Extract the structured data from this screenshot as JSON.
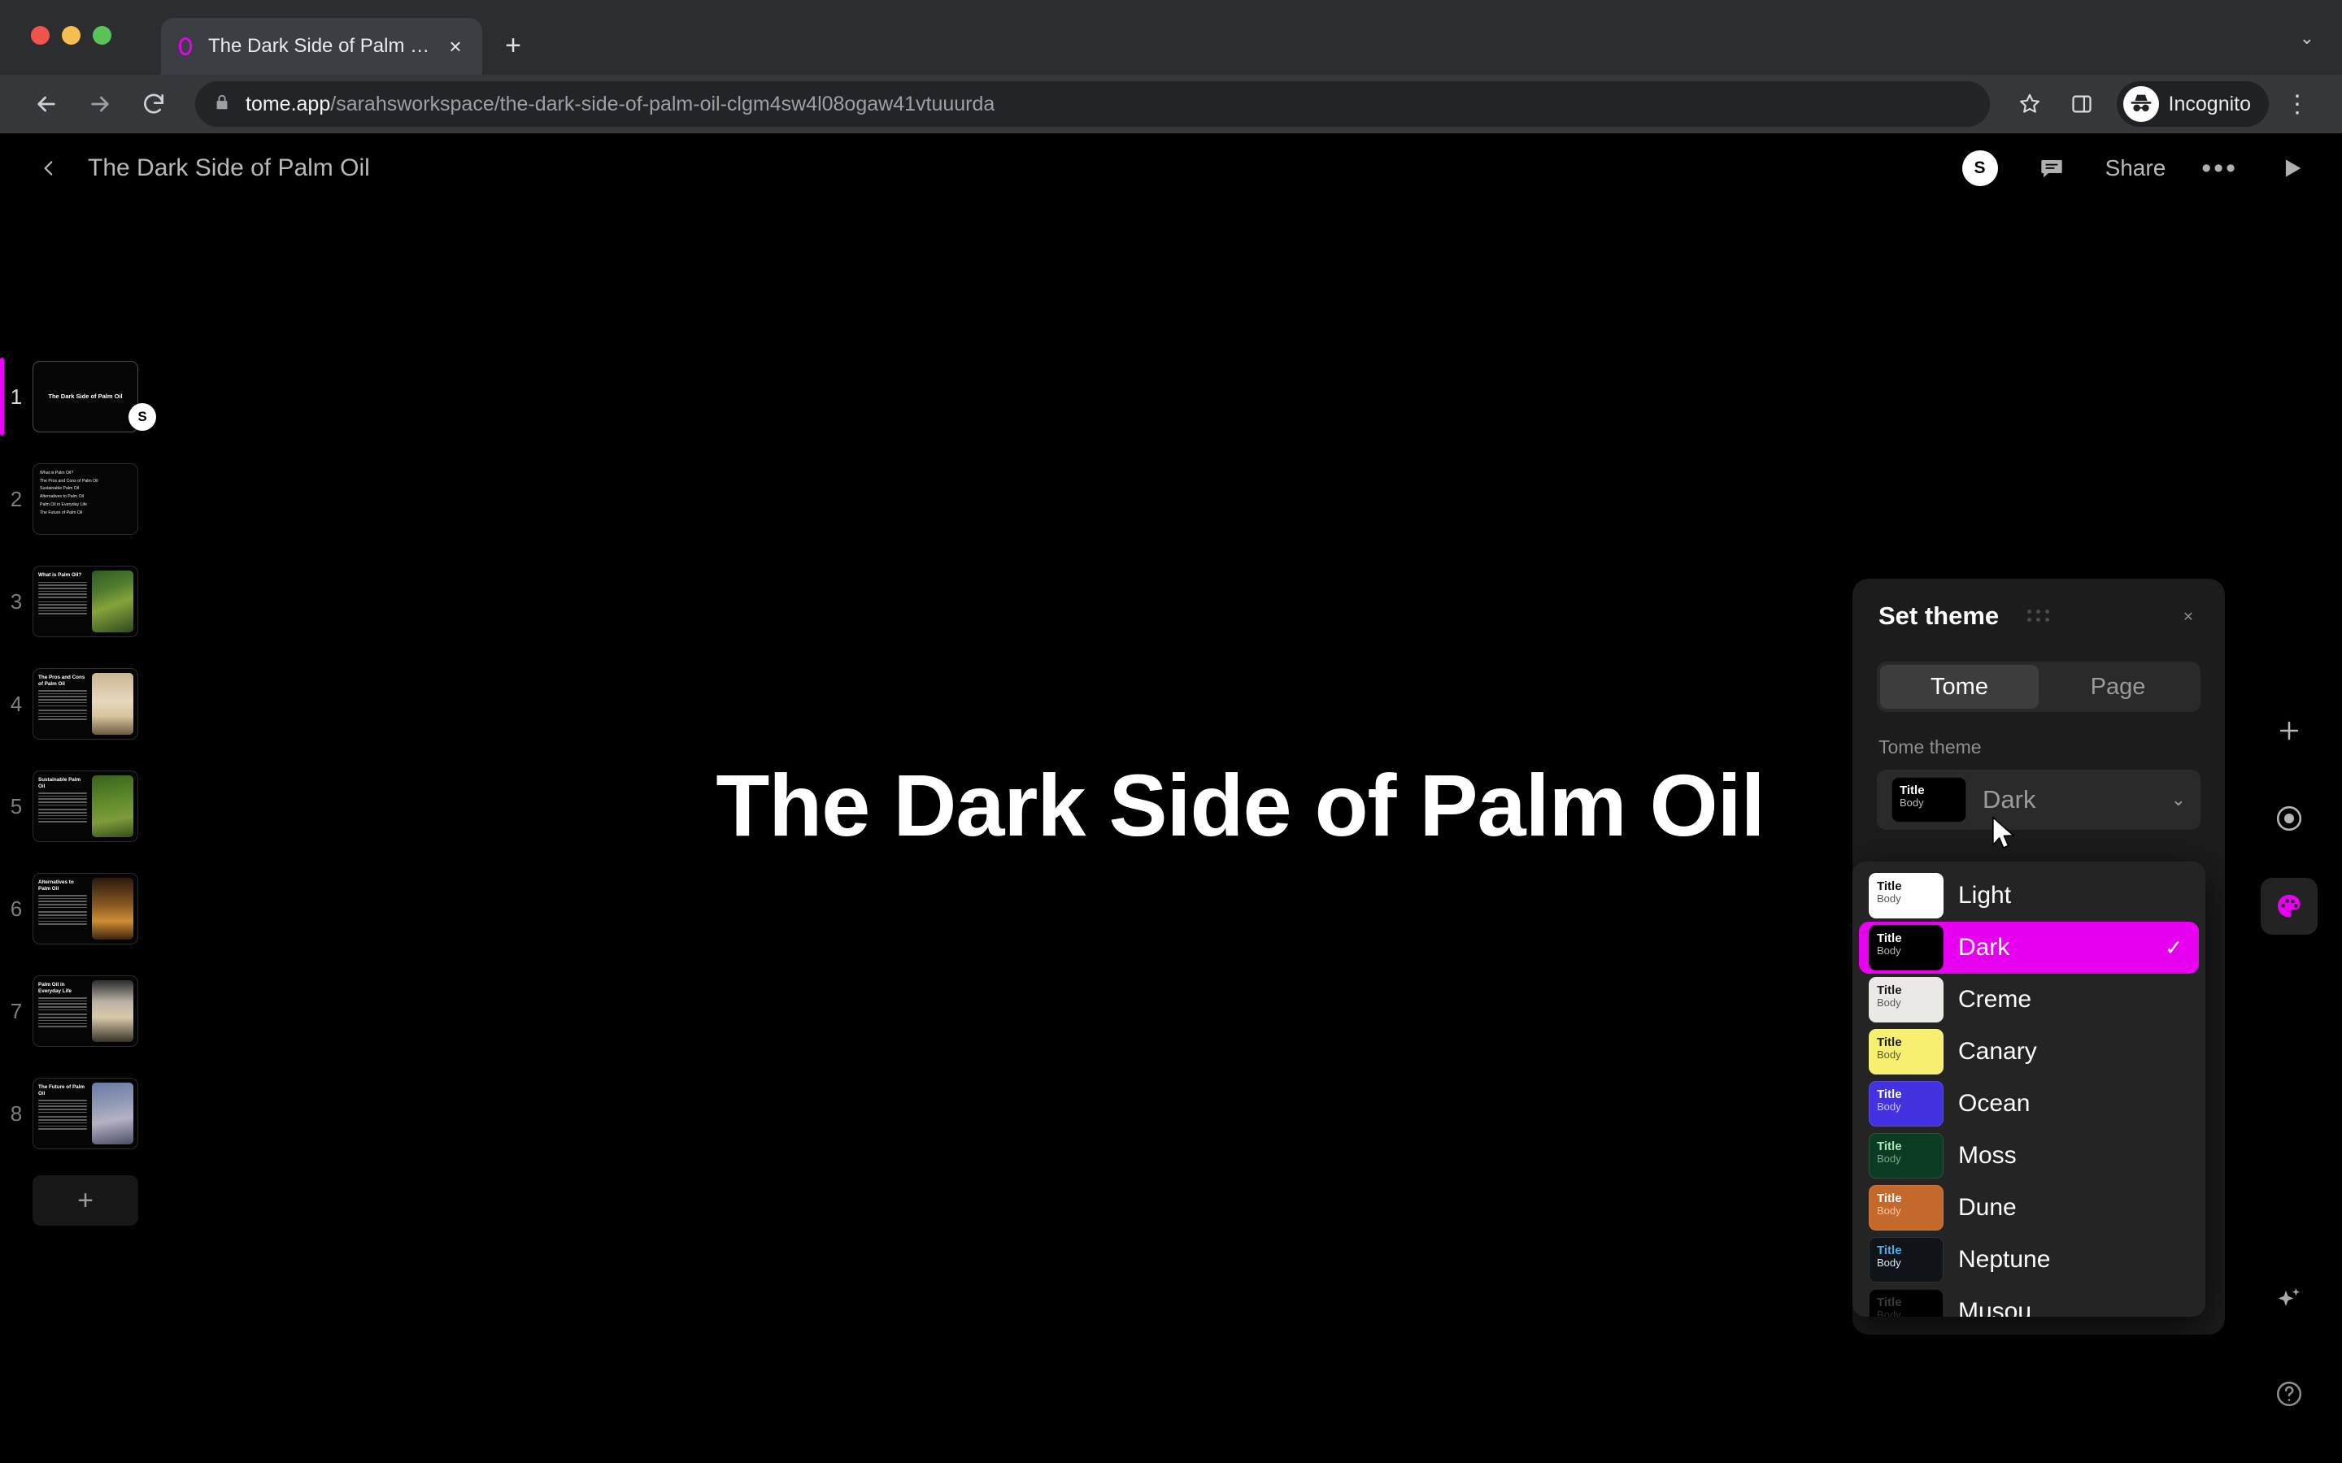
{
  "browser": {
    "tab": {
      "title": "The Dark Side of Palm Oil",
      "favicon": "tome-logo-icon",
      "close": "×"
    },
    "new_tab": "+",
    "tabstrip_chevron": "⌄",
    "nav": {
      "back": "←",
      "forward": "→",
      "reload": "↻"
    },
    "omnibox": {
      "lock": "lock-icon",
      "host": "tome.app",
      "path": "/sarahsworkspace/the-dark-side-of-palm-oil-clgm4sw4l08ogaw41vtuuurda"
    },
    "bookmark": "☆",
    "side_panel": "side-panel-icon",
    "profile": {
      "label": "Incognito",
      "icon": "incognito-icon"
    },
    "menu": "⋮"
  },
  "app": {
    "header": {
      "back": "‹",
      "title": "The Dark Side of Palm Oil",
      "avatar": "S",
      "comment_icon": "comment-icon",
      "share_label": "Share",
      "more": "•••",
      "play_icon": "play-icon"
    },
    "canvas": {
      "slide_title": "The Dark Side of Palm Oil"
    },
    "add_slide": "+",
    "tools": {
      "add": "+",
      "record": "record-icon",
      "theme": "palette-icon",
      "ai": "sparkles-icon",
      "help": "?"
    },
    "slides": [
      {
        "num": "1",
        "type": "title",
        "title": "The Dark Side of Palm Oil",
        "active": true,
        "avatar": "S"
      },
      {
        "num": "2",
        "type": "list",
        "items": [
          "What is Palm Oil?",
          "The Pros and Cons of Palm Oil",
          "Sustainable Palm Oil",
          "Alternatives to Palm Oil",
          "Palm Oil in Everyday Life",
          "The Future of Palm Oil"
        ]
      },
      {
        "num": "3",
        "type": "split",
        "title": "What is Palm Oil?",
        "image": "img-jungle"
      },
      {
        "num": "4",
        "type": "split",
        "title": "The Pros and Cons of Palm Oil",
        "image": "img-sunset"
      },
      {
        "num": "5",
        "type": "split",
        "title": "Sustainable Palm Oil",
        "image": "img-plantation"
      },
      {
        "num": "6",
        "type": "split",
        "title": "Alternatives to Palm Oil",
        "image": "img-bottles"
      },
      {
        "num": "7",
        "type": "split",
        "title": "Palm Oil in Everyday Life",
        "image": "img-shelf"
      },
      {
        "num": "8",
        "type": "split",
        "title": "The Future of Palm Oil",
        "image": "img-city"
      }
    ]
  },
  "theme_panel": {
    "title": "Set theme",
    "close": "✕",
    "tabs": [
      {
        "label": "Tome",
        "active": true
      },
      {
        "label": "Page",
        "active": false
      }
    ],
    "section_label": "Tome theme",
    "selected_value": "Dark",
    "chevron": "⌄",
    "swatch_sample": {
      "title": "Title",
      "body": "Body"
    },
    "selected_swatch": {
      "bg": "#000000",
      "title_color": "#ffffff",
      "body_color": "#b9b9b9"
    },
    "accent_color": "#e800f0",
    "options": [
      {
        "label": "Light",
        "bg": "#ffffff",
        "title_color": "#111111",
        "body_color": "#555555",
        "selected": false
      },
      {
        "label": "Dark",
        "bg": "#000000",
        "title_color": "#ffffff",
        "body_color": "#b9b9b9",
        "selected": true
      },
      {
        "label": "Creme",
        "bg": "#ebe9e5",
        "title_color": "#1b1b1b",
        "body_color": "#5a5a5a",
        "selected": false
      },
      {
        "label": "Canary",
        "bg": "#f6ef6f",
        "title_color": "#1e1e1e",
        "body_color": "#5b5b3a",
        "selected": false
      },
      {
        "label": "Ocean",
        "bg": "#4332e0",
        "title_color": "#ffffff",
        "body_color": "#cfc9f7",
        "selected": false
      },
      {
        "label": "Moss",
        "bg": "#0c3b24",
        "title_color": "#a8e6b8",
        "body_color": "#6fae84",
        "selected": false
      },
      {
        "label": "Dune",
        "bg": "#c4682c",
        "title_color": "#ffffff",
        "body_color": "#f3c9a8",
        "selected": false
      },
      {
        "label": "Neptune",
        "bg": "#101418",
        "title_color": "#49aee8",
        "body_color": "#d7e6f2",
        "selected": false
      },
      {
        "label": "Musou",
        "bg": "#000000",
        "title_color": "#3a3a3a",
        "body_color": "#2e2e2e",
        "selected": false
      }
    ],
    "check_mark": "✓"
  }
}
